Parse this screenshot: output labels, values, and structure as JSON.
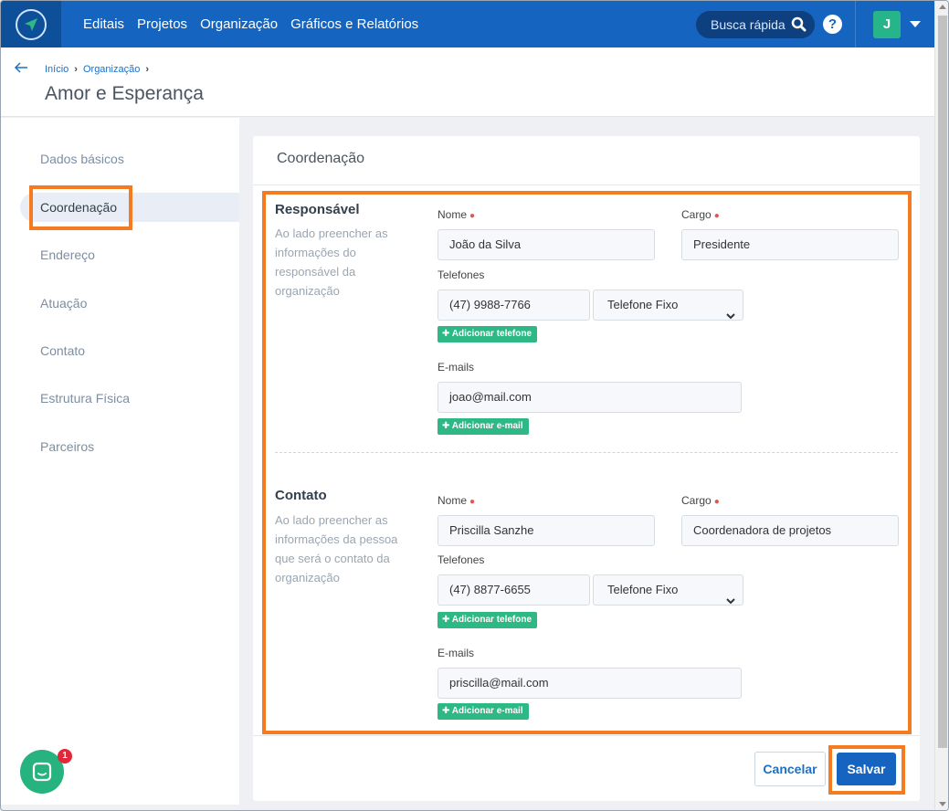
{
  "nav": {
    "items": [
      "Editais",
      "Projetos",
      "Organização",
      "Gráficos e Relatórios"
    ],
    "search_placeholder": "Busca rápida",
    "help_label": "?",
    "avatar_initial": "J"
  },
  "breadcrumb": {
    "items": [
      "Início",
      "Organização"
    ]
  },
  "page": {
    "title": "Amor e Esperança"
  },
  "sidebar": {
    "items": [
      "Dados básicos",
      "Coordenação",
      "Endereço",
      "Atuação",
      "Contato",
      "Estrutura Física",
      "Parceiros"
    ],
    "active": "Coordenação"
  },
  "card": {
    "title": "Coordenação",
    "responsavel": {
      "title": "Responsável",
      "description": "Ao lado preencher as informações do responsável da organização",
      "nome_label": "Nome",
      "nome_value": "João da Silva",
      "cargo_label": "Cargo",
      "cargo_value": "Presidente",
      "telefones_label": "Telefones",
      "telefone_value": "(47) 9988-7766",
      "telefone_tipo": "Telefone Fixo",
      "add_telefone": "Adicionar telefone",
      "emails_label": "E-mails",
      "email_value": "joao@mail.com",
      "add_email": "Adicionar e-mail"
    },
    "contato": {
      "title": "Contato",
      "description": "Ao lado preencher as informações da pessoa que será o contato da organização",
      "nome_label": "Nome",
      "nome_value": "Priscilla Sanzhe",
      "cargo_label": "Cargo",
      "cargo_value": "Coordenadora de projetos",
      "telefones_label": "Telefones",
      "telefone_value": "(47) 8877-6655",
      "telefone_tipo": "Telefone Fixo",
      "add_telefone": "Adicionar telefone",
      "emails_label": "E-mails",
      "email_value": "priscilla@mail.com",
      "add_email": "Adicionar e-mail"
    },
    "cancel_label": "Cancelar",
    "save_label": "Salvar"
  },
  "chat": {
    "badge_count": "1"
  },
  "colors": {
    "primary": "#1565c0",
    "accent_green": "#2eb886",
    "highlight_orange": "#f47b20",
    "required_red": "#e05656"
  },
  "icons": [
    "logo-icon",
    "search-icon",
    "help-icon",
    "chevron-down-icon",
    "back-arrow-icon",
    "plus-icon",
    "chat-icon"
  ]
}
